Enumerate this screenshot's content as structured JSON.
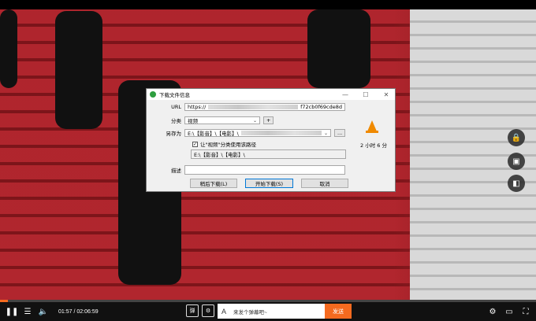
{
  "dialog": {
    "title": "下载文件信息",
    "minimize": "—",
    "maximize": "☐",
    "close": "✕",
    "url_label": "URL",
    "url_prefix": "https://",
    "url_suffix": "f72cb0f69cde8d",
    "category_label": "分类",
    "category_value": "视频",
    "add_category": "+",
    "save_as_label": "另存为",
    "save_as_value": "E:\\【影音】\\【电影】\\",
    "browse": "...",
    "remember_checkbox": "让\"视频\"分类使用该路径",
    "path_display": "E:\\【影音】\\【电影】\\",
    "description_label": "描述",
    "description_value": "",
    "eta": "2 小时 6 分",
    "btn_later": "稍后下载(L)",
    "btn_start": "开始下载(S)",
    "btn_cancel": "取消"
  },
  "player": {
    "time": "01:57 / 02:06:59",
    "progress": 0.015,
    "danmu_placeholder": "来发个弹幕吧~",
    "send_label": "发送",
    "icons": [
      "lock-icon",
      "snapshot-icon",
      "pip-icon",
      "play-pause-icon",
      "playlist-icon",
      "volume-icon",
      "danmu-toggle-icon",
      "danmu-settings-icon",
      "settings-icon",
      "window-icon",
      "fullscreen-icon"
    ]
  },
  "colors": {
    "accent": "#f56a1f"
  }
}
